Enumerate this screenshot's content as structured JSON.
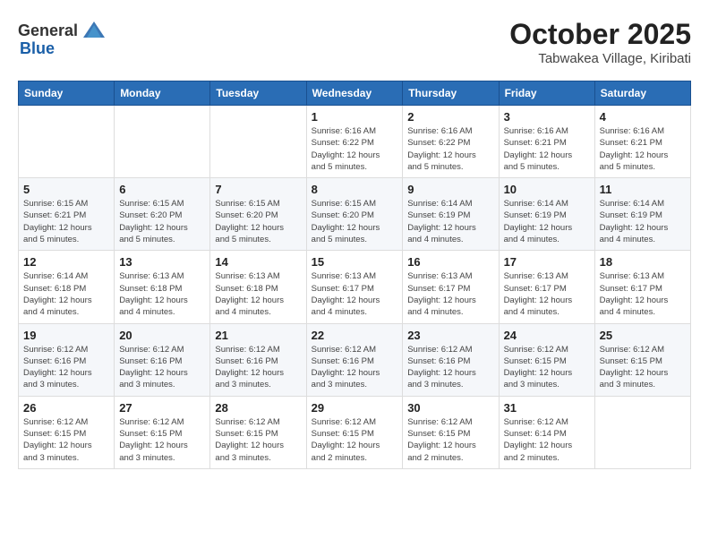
{
  "header": {
    "logo_general": "General",
    "logo_blue": "Blue",
    "month_title": "October 2025",
    "location": "Tabwakea Village, Kiribati"
  },
  "weekdays": [
    "Sunday",
    "Monday",
    "Tuesday",
    "Wednesday",
    "Thursday",
    "Friday",
    "Saturday"
  ],
  "weeks": [
    [
      {
        "day": "",
        "detail": ""
      },
      {
        "day": "",
        "detail": ""
      },
      {
        "day": "",
        "detail": ""
      },
      {
        "day": "1",
        "detail": "Sunrise: 6:16 AM\nSunset: 6:22 PM\nDaylight: 12 hours\nand 5 minutes."
      },
      {
        "day": "2",
        "detail": "Sunrise: 6:16 AM\nSunset: 6:22 PM\nDaylight: 12 hours\nand 5 minutes."
      },
      {
        "day": "3",
        "detail": "Sunrise: 6:16 AM\nSunset: 6:21 PM\nDaylight: 12 hours\nand 5 minutes."
      },
      {
        "day": "4",
        "detail": "Sunrise: 6:16 AM\nSunset: 6:21 PM\nDaylight: 12 hours\nand 5 minutes."
      }
    ],
    [
      {
        "day": "5",
        "detail": "Sunrise: 6:15 AM\nSunset: 6:21 PM\nDaylight: 12 hours\nand 5 minutes."
      },
      {
        "day": "6",
        "detail": "Sunrise: 6:15 AM\nSunset: 6:20 PM\nDaylight: 12 hours\nand 5 minutes."
      },
      {
        "day": "7",
        "detail": "Sunrise: 6:15 AM\nSunset: 6:20 PM\nDaylight: 12 hours\nand 5 minutes."
      },
      {
        "day": "8",
        "detail": "Sunrise: 6:15 AM\nSunset: 6:20 PM\nDaylight: 12 hours\nand 5 minutes."
      },
      {
        "day": "9",
        "detail": "Sunrise: 6:14 AM\nSunset: 6:19 PM\nDaylight: 12 hours\nand 4 minutes."
      },
      {
        "day": "10",
        "detail": "Sunrise: 6:14 AM\nSunset: 6:19 PM\nDaylight: 12 hours\nand 4 minutes."
      },
      {
        "day": "11",
        "detail": "Sunrise: 6:14 AM\nSunset: 6:19 PM\nDaylight: 12 hours\nand 4 minutes."
      }
    ],
    [
      {
        "day": "12",
        "detail": "Sunrise: 6:14 AM\nSunset: 6:18 PM\nDaylight: 12 hours\nand 4 minutes."
      },
      {
        "day": "13",
        "detail": "Sunrise: 6:13 AM\nSunset: 6:18 PM\nDaylight: 12 hours\nand 4 minutes."
      },
      {
        "day": "14",
        "detail": "Sunrise: 6:13 AM\nSunset: 6:18 PM\nDaylight: 12 hours\nand 4 minutes."
      },
      {
        "day": "15",
        "detail": "Sunrise: 6:13 AM\nSunset: 6:17 PM\nDaylight: 12 hours\nand 4 minutes."
      },
      {
        "day": "16",
        "detail": "Sunrise: 6:13 AM\nSunset: 6:17 PM\nDaylight: 12 hours\nand 4 minutes."
      },
      {
        "day": "17",
        "detail": "Sunrise: 6:13 AM\nSunset: 6:17 PM\nDaylight: 12 hours\nand 4 minutes."
      },
      {
        "day": "18",
        "detail": "Sunrise: 6:13 AM\nSunset: 6:17 PM\nDaylight: 12 hours\nand 4 minutes."
      }
    ],
    [
      {
        "day": "19",
        "detail": "Sunrise: 6:12 AM\nSunset: 6:16 PM\nDaylight: 12 hours\nand 3 minutes."
      },
      {
        "day": "20",
        "detail": "Sunrise: 6:12 AM\nSunset: 6:16 PM\nDaylight: 12 hours\nand 3 minutes."
      },
      {
        "day": "21",
        "detail": "Sunrise: 6:12 AM\nSunset: 6:16 PM\nDaylight: 12 hours\nand 3 minutes."
      },
      {
        "day": "22",
        "detail": "Sunrise: 6:12 AM\nSunset: 6:16 PM\nDaylight: 12 hours\nand 3 minutes."
      },
      {
        "day": "23",
        "detail": "Sunrise: 6:12 AM\nSunset: 6:16 PM\nDaylight: 12 hours\nand 3 minutes."
      },
      {
        "day": "24",
        "detail": "Sunrise: 6:12 AM\nSunset: 6:15 PM\nDaylight: 12 hours\nand 3 minutes."
      },
      {
        "day": "25",
        "detail": "Sunrise: 6:12 AM\nSunset: 6:15 PM\nDaylight: 12 hours\nand 3 minutes."
      }
    ],
    [
      {
        "day": "26",
        "detail": "Sunrise: 6:12 AM\nSunset: 6:15 PM\nDaylight: 12 hours\nand 3 minutes."
      },
      {
        "day": "27",
        "detail": "Sunrise: 6:12 AM\nSunset: 6:15 PM\nDaylight: 12 hours\nand 3 minutes."
      },
      {
        "day": "28",
        "detail": "Sunrise: 6:12 AM\nSunset: 6:15 PM\nDaylight: 12 hours\nand 3 minutes."
      },
      {
        "day": "29",
        "detail": "Sunrise: 6:12 AM\nSunset: 6:15 PM\nDaylight: 12 hours\nand 2 minutes."
      },
      {
        "day": "30",
        "detail": "Sunrise: 6:12 AM\nSunset: 6:15 PM\nDaylight: 12 hours\nand 2 minutes."
      },
      {
        "day": "31",
        "detail": "Sunrise: 6:12 AM\nSunset: 6:14 PM\nDaylight: 12 hours\nand 2 minutes."
      },
      {
        "day": "",
        "detail": ""
      }
    ]
  ]
}
